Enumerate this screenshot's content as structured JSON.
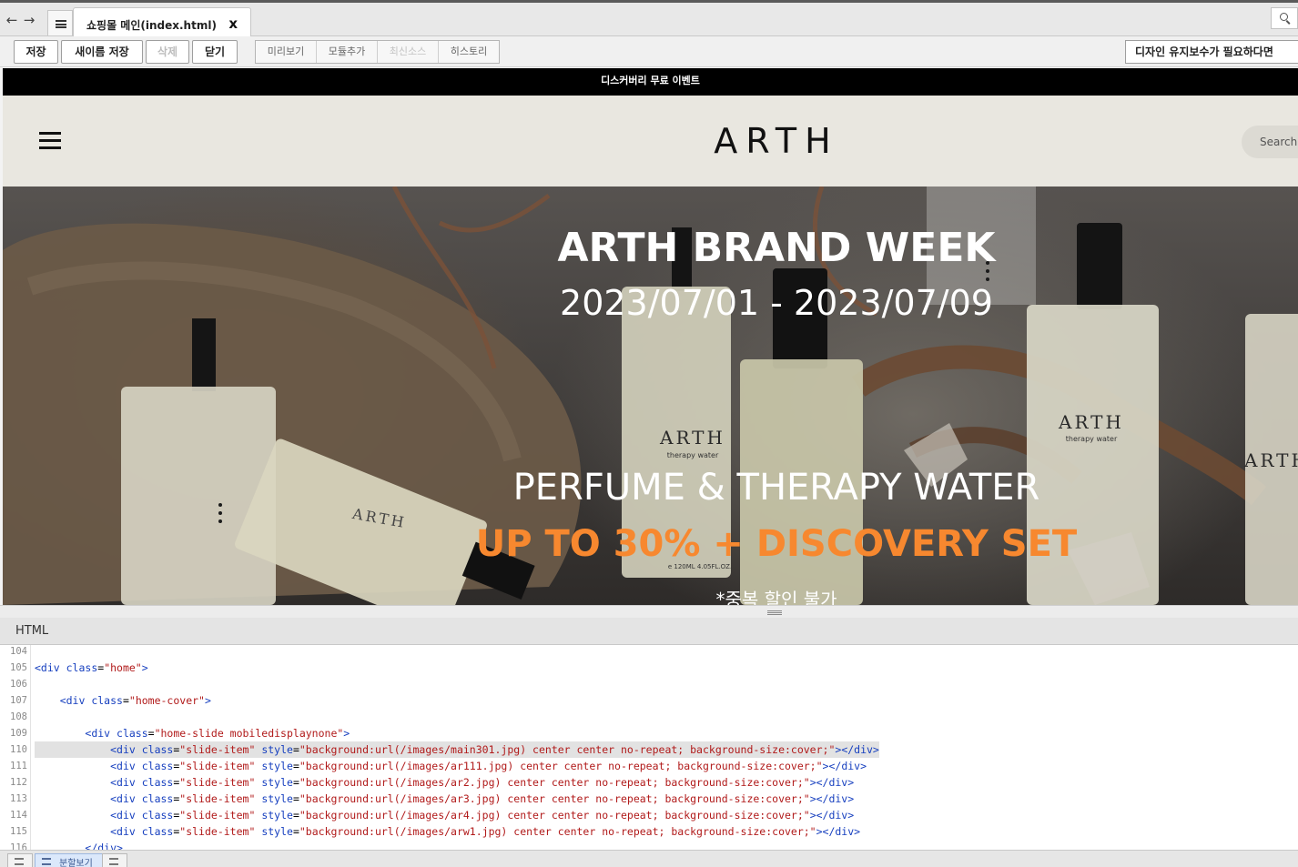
{
  "tabs": {
    "active_title": "쇼핑몰 메인(index.html)",
    "close_glyph": "x"
  },
  "nav": {
    "back_glyph": "←",
    "forward_glyph": "→"
  },
  "toolbar": {
    "save": "저장",
    "save_as": "새이름 저장",
    "delete": "삭제",
    "close": "닫기",
    "preview": "미리보기",
    "add_module": "모듈추가",
    "latest_source": "최신소스",
    "history": "히스토리",
    "maintenance_notice": "디자인 유지보수가 필요하다면"
  },
  "site": {
    "topband_text": "디스커버리 무료 이벤트",
    "logo": "ARTH",
    "search_placeholder": "Search",
    "hero": {
      "title": "ARTH BRAND WEEK",
      "dates": "2023/07/01 - 2023/07/09",
      "subtitle": "PERFUME & THERAPY WATER",
      "promo": "UP TO 30% + DISCOVERY SET",
      "note": "*중복 할인 불가",
      "bottle_brand": "ARTH",
      "bottle_label": "therapy water",
      "bottle_volume": "e 120ML 4.05FL.OZ."
    }
  },
  "editor": {
    "panel_title": "HTML",
    "lines": [
      {
        "n": "104",
        "indent": "",
        "tokens": []
      },
      {
        "n": "105",
        "indent": "",
        "tokens": [
          [
            "tag",
            "<div "
          ],
          [
            "attr",
            "class"
          ],
          [
            "txt",
            "="
          ],
          [
            "val",
            "\"home\""
          ],
          [
            "tag",
            ">"
          ]
        ]
      },
      {
        "n": "106",
        "indent": "",
        "tokens": []
      },
      {
        "n": "107",
        "indent": "    ",
        "tokens": [
          [
            "tag",
            "<div "
          ],
          [
            "attr",
            "class"
          ],
          [
            "txt",
            "="
          ],
          [
            "val",
            "\"home-cover\""
          ],
          [
            "tag",
            ">"
          ]
        ]
      },
      {
        "n": "108",
        "indent": "",
        "tokens": []
      },
      {
        "n": "109",
        "indent": "        ",
        "tokens": [
          [
            "tag",
            "<div "
          ],
          [
            "attr",
            "class"
          ],
          [
            "txt",
            "="
          ],
          [
            "val",
            "\"home-slide mobiledisplaynone\""
          ],
          [
            "tag",
            ">"
          ]
        ]
      },
      {
        "n": "110",
        "indent": "            ",
        "highlight": true,
        "tokens": [
          [
            "tag",
            "<div "
          ],
          [
            "attr",
            "class"
          ],
          [
            "txt",
            "="
          ],
          [
            "val",
            "\"slide-item\""
          ],
          [
            "txt",
            " "
          ],
          [
            "attr",
            "style"
          ],
          [
            "txt",
            "="
          ],
          [
            "val",
            "\"background:url(/images/main301.jpg) center center no-repeat; background-size:cover;\""
          ],
          [
            "tag",
            "></div>"
          ]
        ]
      },
      {
        "n": "111",
        "indent": "            ",
        "tokens": [
          [
            "tag",
            "<div "
          ],
          [
            "attr",
            "class"
          ],
          [
            "txt",
            "="
          ],
          [
            "val",
            "\"slide-item\""
          ],
          [
            "txt",
            " "
          ],
          [
            "attr",
            "style"
          ],
          [
            "txt",
            "="
          ],
          [
            "val",
            "\"background:url(/images/ar111.jpg) center center no-repeat; background-size:cover;\""
          ],
          [
            "tag",
            "></div>"
          ]
        ]
      },
      {
        "n": "112",
        "indent": "            ",
        "tokens": [
          [
            "tag",
            "<div "
          ],
          [
            "attr",
            "class"
          ],
          [
            "txt",
            "="
          ],
          [
            "val",
            "\"slide-item\""
          ],
          [
            "txt",
            " "
          ],
          [
            "attr",
            "style"
          ],
          [
            "txt",
            "="
          ],
          [
            "val",
            "\"background:url(/images/ar2.jpg) center center no-repeat; background-size:cover;\""
          ],
          [
            "tag",
            "></div>"
          ]
        ]
      },
      {
        "n": "113",
        "indent": "            ",
        "tokens": [
          [
            "tag",
            "<div "
          ],
          [
            "attr",
            "class"
          ],
          [
            "txt",
            "="
          ],
          [
            "val",
            "\"slide-item\""
          ],
          [
            "txt",
            " "
          ],
          [
            "attr",
            "style"
          ],
          [
            "txt",
            "="
          ],
          [
            "val",
            "\"background:url(/images/ar3.jpg) center center no-repeat; background-size:cover;\""
          ],
          [
            "tag",
            "></div>"
          ]
        ]
      },
      {
        "n": "114",
        "indent": "            ",
        "tokens": [
          [
            "tag",
            "<div "
          ],
          [
            "attr",
            "class"
          ],
          [
            "txt",
            "="
          ],
          [
            "val",
            "\"slide-item\""
          ],
          [
            "txt",
            " "
          ],
          [
            "attr",
            "style"
          ],
          [
            "txt",
            "="
          ],
          [
            "val",
            "\"background:url(/images/ar4.jpg) center center no-repeat; background-size:cover;\""
          ],
          [
            "tag",
            "></div>"
          ]
        ]
      },
      {
        "n": "115",
        "indent": "            ",
        "tokens": [
          [
            "tag",
            "<div "
          ],
          [
            "attr",
            "class"
          ],
          [
            "txt",
            "="
          ],
          [
            "val",
            "\"slide-item\""
          ],
          [
            "txt",
            " "
          ],
          [
            "attr",
            "style"
          ],
          [
            "txt",
            "="
          ],
          [
            "val",
            "\"background:url(/images/arw1.jpg) center center no-repeat; background-size:cover;\""
          ],
          [
            "tag",
            "></div>"
          ]
        ]
      },
      {
        "n": "116",
        "indent": "        ",
        "tokens": [
          [
            "tag",
            "</div>"
          ]
        ]
      }
    ]
  },
  "bottombar": {
    "split_view_label": "분할보기"
  },
  "colors": {
    "promo_orange": "#f7882f",
    "header_beige": "#e9e7e0",
    "code_value_red": "#b11a1a",
    "code_tag_blue": "#163fbf"
  }
}
